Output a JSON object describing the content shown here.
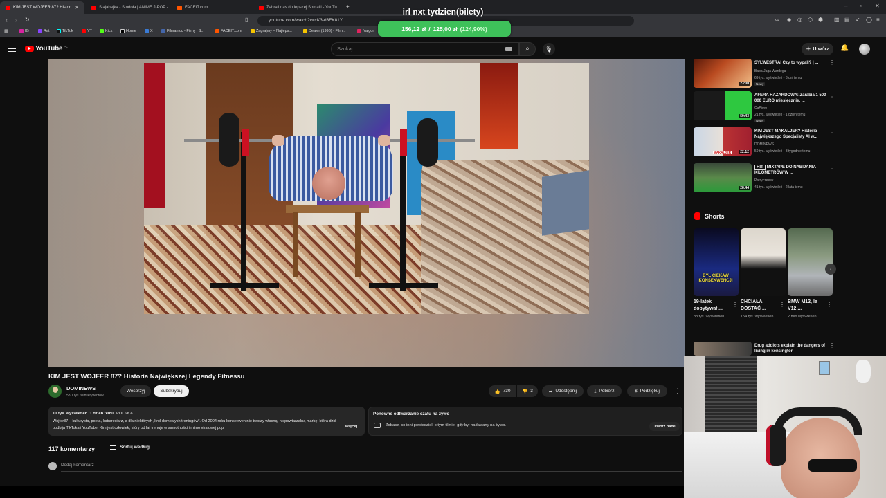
{
  "browser": {
    "tabs": [
      {
        "title": "KIM JEST WOJFER 87? Histori",
        "active": true,
        "color": "#ff0000"
      },
      {
        "title": "Siajabajka - Stodoła | ANIME J-POP -",
        "active": false,
        "color": "#ff0000"
      },
      {
        "title": "FACEIT.com",
        "active": false,
        "color": "#ff5500"
      },
      {
        "title": "Zabrali nas do lepszej Somalii - YouTu",
        "active": false,
        "color": "#ff0000"
      }
    ],
    "url": "youtube.com/watch?v=xK3-d3FK81Y",
    "bookmarks": [
      "IG",
      "Rat",
      "TikTok",
      "YT",
      "Kick",
      "Home",
      "X",
      "Filman.cc - Filmy i S...",
      "FACEIT.com",
      "Zagrajmy – Najleps...",
      "Dealer (1996) - Film...",
      "Najgor"
    ]
  },
  "overlay": {
    "title": "irl nxt tydzien(bilety)",
    "current": "156,12 zł",
    "separator": "/",
    "goal": "125,00 zł",
    "percent": "(124,90%)",
    "color": "#3ec15a"
  },
  "youtube": {
    "logo": "YouTube",
    "country": "PL",
    "search_placeholder": "Szukaj",
    "create_label": "Utwórz"
  },
  "video": {
    "title": "KIM JEST WOJFER 87? Historia Największej Legendy Fitnessu",
    "channel": "DOMINEWS",
    "subscribers": "58,1 tys. subskrybentów",
    "support_label": "Wesprzyj",
    "subscribe_label": "Subskrybuj",
    "likes": "730",
    "dislikes": "3",
    "share_label": "Udostępnij",
    "download_label": "Pobierz",
    "thanks_label": "Podziękuj",
    "more_label": "⋮"
  },
  "description": {
    "views": "10 tys. wyświetleń",
    "date": "1 dzień temu",
    "location": "POLSKA",
    "text": "Wojfer87 – kulturysta, poeta, kabareciarz, a dla niektórych „król domowych treningów\". Od 2004 roku konsekwentnie tworzy własną, niepowtarzalną markę, która dziś podbija TikToka i YouTube. Kim jest człowiek, który od lat trenuje w samotności i mimo viralowej pop",
    "more": "...więcej"
  },
  "chat_replay": {
    "title": "Ponowne odtwarzanie czatu na żywo",
    "text": "Zobacz, co inni powiedzieli o tym filmie, gdy był nadawany na żywo.",
    "button": "Otwórz panel"
  },
  "comments": {
    "count": "117 komentarzy",
    "sort_label": "Sortuj według",
    "add_placeholder": "Dodaj komentarz"
  },
  "recommendations": [
    {
      "title": "SYLWESTRAI Czy to wypali? | ...",
      "channel": "Baba Jaga Wardega",
      "meta": "69 tys. wyświetleń • 3 dni temu",
      "badge": "Nowy",
      "duration": "23:00"
    },
    {
      "title": "AFERA HAZARDOWA: Zarabia 1 500 000 EURO miesięcznie, ...",
      "channel": "CaPioro",
      "meta": "21 tys. wyświetleń • 1 dzień temu",
      "badge": "Nowy",
      "duration": "59:43"
    },
    {
      "title": "KIM JEST MAKALJER? Historia Największego Specjalisty AI w...",
      "channel": "DOMINEWS",
      "meta": "59 tys. wyświetleń • 3 tygodnie temu",
      "badge": "",
      "duration": "22:12",
      "thumb_label": "MAKALJER"
    },
    {
      "title": "MIXTAPE DO NABIJANIA KILOMETRÓW W ...",
      "channel": "Patryczeeek",
      "meta": "41 tys. wyświetleń • 2 lata temu",
      "badge": "",
      "duration": "28:44",
      "thumb_label": "HIT"
    },
    {
      "title": "Drug addicts explain the dangers of living in kensington",
      "channel": "",
      "meta": "",
      "badge": "",
      "duration": ""
    }
  ],
  "shorts": {
    "heading": "Shorts",
    "items": [
      {
        "title": "19-latek dopytywał ...",
        "views": "88 tys. wyświetleń",
        "caption": "BYŁ CIEKAW KONSEKWENCJI"
      },
      {
        "title": "CHCIAŁA DOSTAĆ ...",
        "views": "154 tys. wyświetleń",
        "caption": ""
      },
      {
        "title": "BMW M12, le V12 ...",
        "views": "2 mln wyświetleń",
        "caption": ""
      }
    ]
  }
}
